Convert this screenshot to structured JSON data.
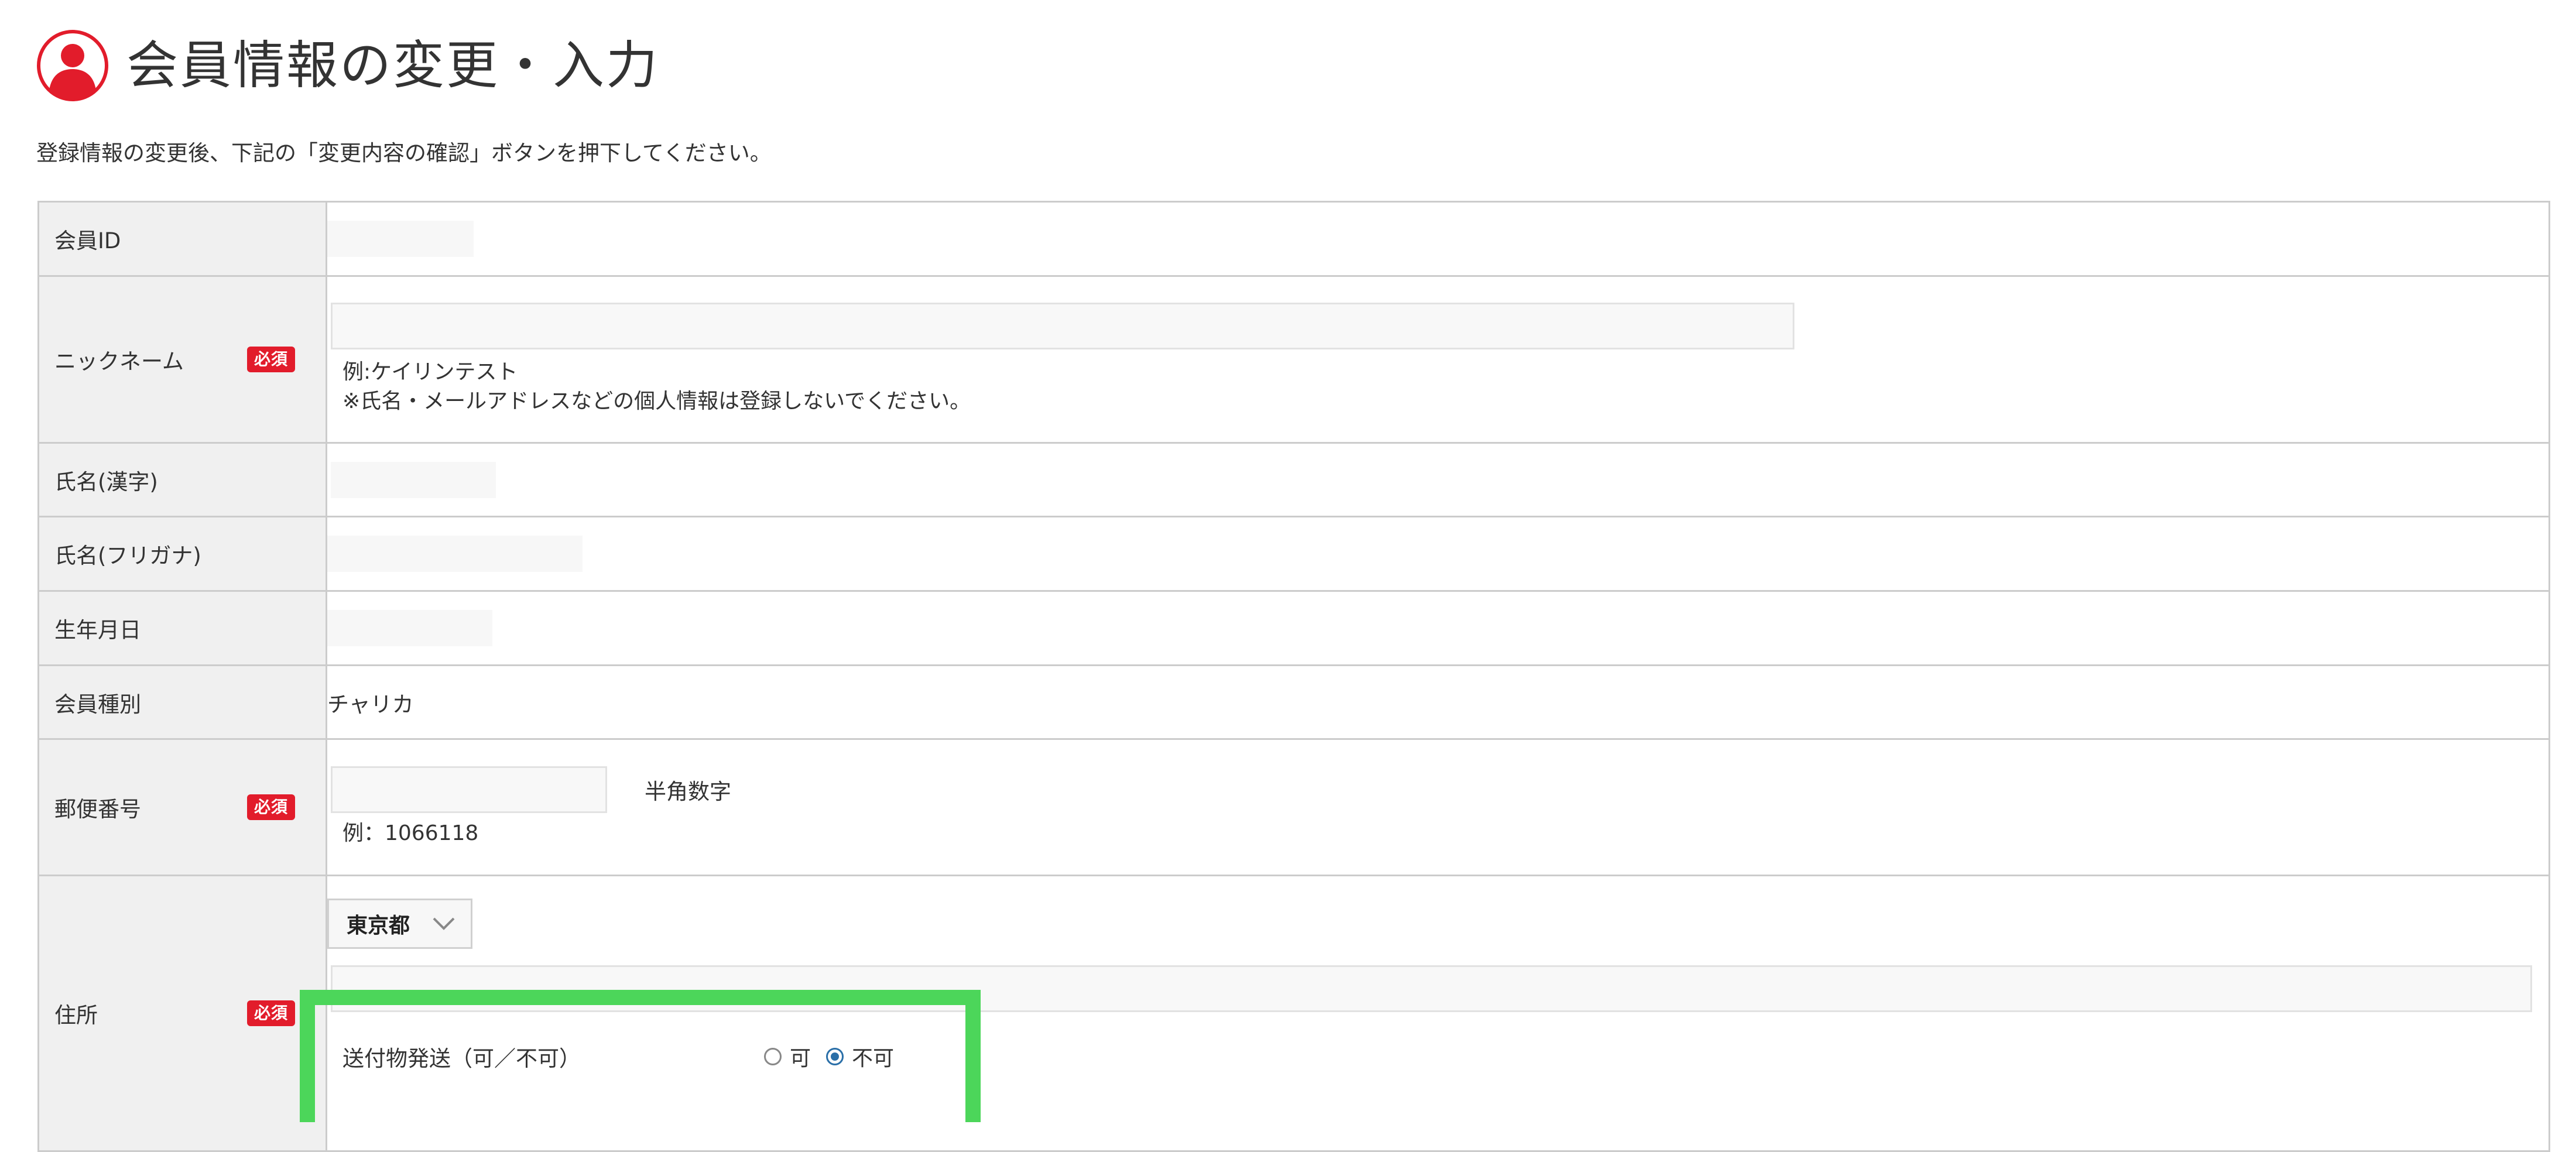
{
  "header": {
    "title": "会員情報の変更・入力",
    "icon": "user-icon",
    "accent_color": "#e21c2b"
  },
  "intro": "登録情報の変更後、下記の「変更内容の確認」ボタンを押下してください。",
  "required_label": "必須",
  "rows": {
    "member_id": {
      "label": "会員ID"
    },
    "nickname": {
      "label": "ニックネーム",
      "value": "",
      "example": "例:ケイリンテスト",
      "note": "※氏名・メールアドレスなどの個人情報は登録しないでください。"
    },
    "name_kanji": {
      "label": "氏名(漢字)"
    },
    "name_kana": {
      "label": "氏名(フリガナ)"
    },
    "birthdate": {
      "label": "生年月日"
    },
    "member_type": {
      "label": "会員種別",
      "value": "チャリカ"
    },
    "postal_code": {
      "label": "郵便番号",
      "value": "",
      "hint": "半角数字",
      "example": "例：1066118"
    },
    "address": {
      "label": "住所",
      "prefecture": "東京都",
      "street_value": "",
      "shipping_label": "送付物発送（可／不可）",
      "option_yes": "可",
      "option_no": "不可",
      "selected": "不可"
    }
  },
  "highlight_color": "#4cd65a"
}
